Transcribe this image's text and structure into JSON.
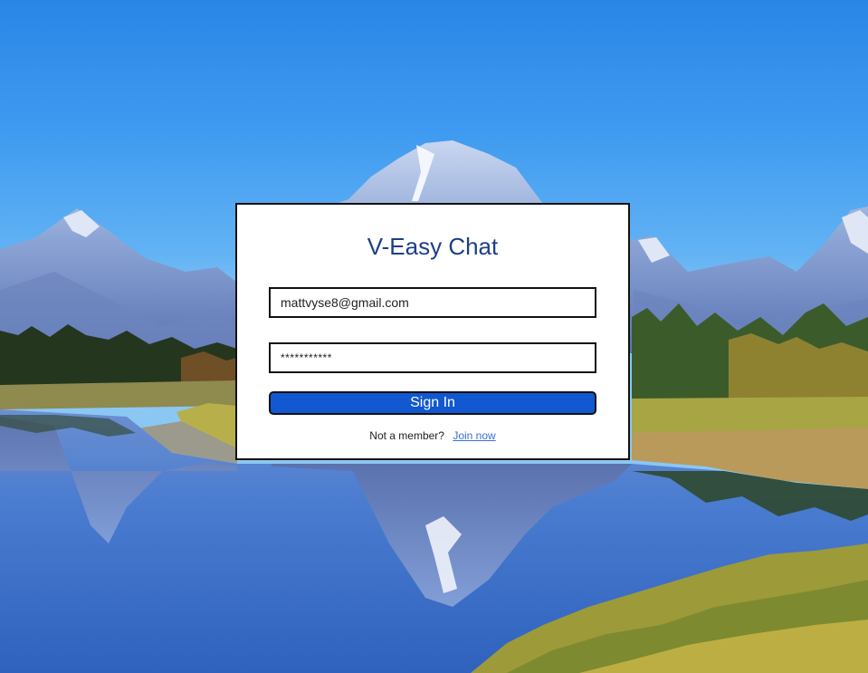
{
  "background": {
    "scene": "mountain-lake",
    "colors": {
      "sky": "#3f9bf0",
      "mountain": "#8fa9d6",
      "snow": "#e8eef9",
      "forest": "#2f4a2a",
      "meadow": "#b8b04a",
      "water": "#3b73c8"
    }
  },
  "login": {
    "app_title": "V-Easy Chat",
    "email_value": "mattvyse8@gmail.com",
    "password_masked": "***********",
    "signin_label": "Sign In",
    "not_member_text": "Not a member?",
    "join_link_label": "Join now"
  },
  "colors": {
    "title": "#1d3f86",
    "button": "#1158d1",
    "link": "#3a6fd0"
  }
}
